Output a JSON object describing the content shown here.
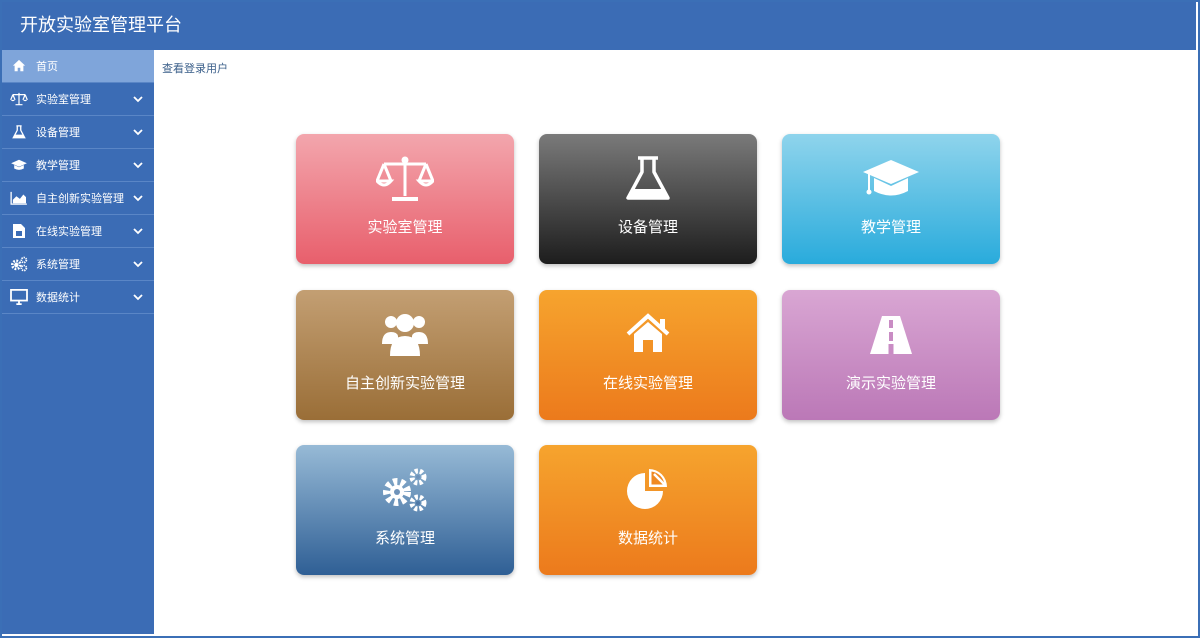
{
  "header": {
    "title": "开放实验室管理平台"
  },
  "breadcrumb": "查看登录用户",
  "sidebar": {
    "items": [
      {
        "label": "首页",
        "icon": "home-icon",
        "active": true
      },
      {
        "label": "实验室管理",
        "icon": "balance-scale-icon"
      },
      {
        "label": "设备管理",
        "icon": "flask-icon"
      },
      {
        "label": "教学管理",
        "icon": "graduation-cap-icon"
      },
      {
        "label": "自主创新实验管理",
        "icon": "area-chart-icon"
      },
      {
        "label": "在线实验管理",
        "icon": "document-icon"
      },
      {
        "label": "系统管理",
        "icon": "gears-icon"
      },
      {
        "label": "数据统计",
        "icon": "monitor-icon"
      }
    ]
  },
  "tiles": [
    {
      "label": "实验室管理",
      "icon": "balance-scale-icon",
      "colors": [
        "#f3a6ad",
        "#e85f6c"
      ]
    },
    {
      "label": "设备管理",
      "icon": "flask-icon",
      "colors": [
        "#7a7a7a",
        "#1d1d1d"
      ]
    },
    {
      "label": "教学管理",
      "icon": "graduation-cap-icon",
      "colors": [
        "#8fd4ec",
        "#29abdc"
      ]
    },
    {
      "label": "自主创新实验管理",
      "icon": "users-icon",
      "colors": [
        "#c39f73",
        "#9a6e37"
      ]
    },
    {
      "label": "在线实验管理",
      "icon": "home-icon",
      "colors": [
        "#f6a42e",
        "#ec7a1c"
      ]
    },
    {
      "label": "演示实验管理",
      "icon": "road-icon",
      "colors": [
        "#d9a6d3",
        "#bb78b7"
      ]
    },
    {
      "label": "系统管理",
      "icon": "gears-icon",
      "colors": [
        "#97bad6",
        "#2f5f95"
      ]
    },
    {
      "label": "数据统计",
      "icon": "pie-chart-icon",
      "colors": [
        "#f6a42e",
        "#ec7a1c"
      ]
    }
  ]
}
